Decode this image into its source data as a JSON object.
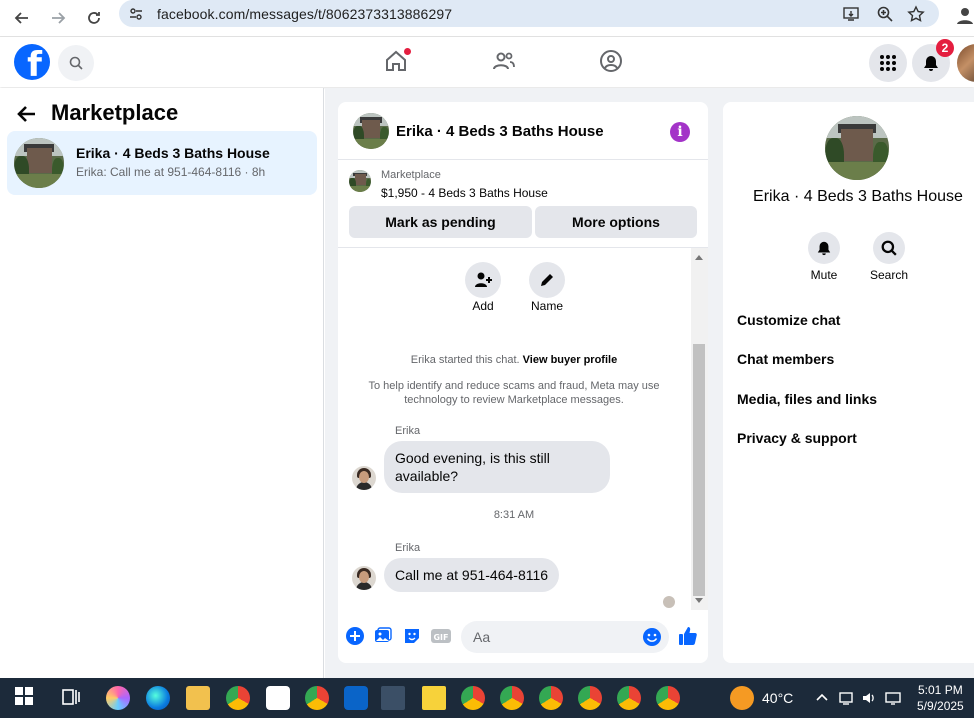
{
  "browser": {
    "url": "facebook.com/messages/t/8062373313886297"
  },
  "header": {
    "notification_count": "2"
  },
  "sidebar": {
    "title": "Marketplace",
    "conversation": {
      "name": "Erika · 4 Beds 3 Baths House",
      "preview": "Erika: Call me at 951-464-8116 · 8h"
    }
  },
  "chat": {
    "title": "Erika · 4 Beds 3 Baths House",
    "listing": {
      "source": "Marketplace",
      "price_title": "$1,950 - 4 Beds 3 Baths House"
    },
    "buttons": {
      "mark_pending": "Mark as pending",
      "more_options": "More options"
    },
    "thread_actions": {
      "add": "Add",
      "name": "Name"
    },
    "system": {
      "started": "Erika started this chat.",
      "view_profile": "View buyer profile",
      "scam_notice": "To help identify and reduce scams and fraud, Meta may use technology to review Marketplace messages."
    },
    "messages": [
      {
        "sender": "Erika",
        "text": "Good evening, is this still available?"
      },
      {
        "sender": "Erika",
        "text": "Call me at 951-464-8116"
      }
    ],
    "time_separator": "8:31 AM",
    "composer_placeholder": "Aa"
  },
  "details": {
    "name": "Erika · 4 Beds 3 Baths House",
    "actions": {
      "mute": "Mute",
      "search": "Search"
    },
    "sections": [
      "Customize chat",
      "Chat members",
      "Media, files and links",
      "Privacy & support"
    ]
  },
  "taskbar": {
    "weather": "40°C",
    "time": "5:01 PM",
    "date": "5/9/2025"
  },
  "colors": {
    "brand": "#0866ff",
    "selected_row": "#e7f3ff",
    "info_purple": "#a333c8",
    "badge_red": "#e41e3f"
  }
}
